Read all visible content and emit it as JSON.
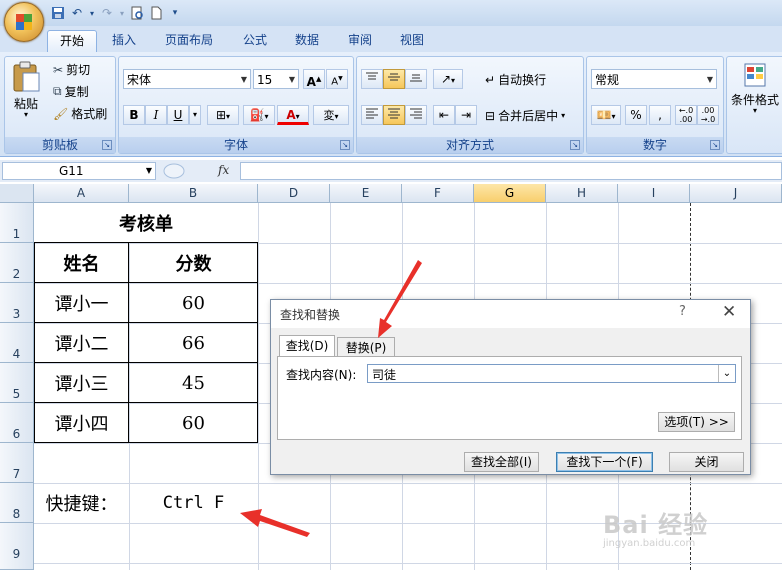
{
  "name_box": "G11",
  "formula_bar": {
    "fx": "fx",
    "value": ""
  },
  "tabs": [
    "开始",
    "插入",
    "页面布局",
    "公式",
    "数据",
    "审阅",
    "视图"
  ],
  "active_tab": "开始",
  "ribbon": {
    "clipboard": {
      "label": "剪贴板",
      "paste": "粘贴",
      "cut": "剪切",
      "copy": "复制",
      "format_painter": "格式刷"
    },
    "font": {
      "label": "字体",
      "name": "宋体",
      "size": "15",
      "bold": "B",
      "italic": "I",
      "underline": "U",
      "grow": "A",
      "shrink": "A",
      "font_color_letter": "A",
      "phonetic": "wén"
    },
    "alignment": {
      "label": "对齐方式",
      "wrap_text": "自动换行",
      "merge_center": "合并后居中"
    },
    "number": {
      "label": "数字",
      "format": "常规",
      "percent": "%",
      "comma": ",",
      "inc_decimal": "+.0\n.00",
      "dec_decimal": ".00\n→.0"
    },
    "styles": {
      "conditional_format": "条件格式"
    }
  },
  "columns": [
    "A",
    "B",
    "D",
    "E",
    "F",
    "G",
    "H",
    "I",
    "J"
  ],
  "selected_column": "G",
  "rows": [
    "1",
    "2",
    "3",
    "4",
    "5",
    "6",
    "7",
    "8",
    "9"
  ],
  "sheet": {
    "title": "考核单",
    "headers": [
      "姓名",
      "分数"
    ],
    "data": [
      {
        "name": "谭小一",
        "score": "60"
      },
      {
        "name": "谭小二",
        "score": "66"
      },
      {
        "name": "谭小三",
        "score": "45"
      },
      {
        "name": "谭小四",
        "score": "60"
      }
    ],
    "shortcut_label": "快捷键：",
    "shortcut_value": "Ctrl F"
  },
  "dialog": {
    "title": "查找和替换",
    "help": "?",
    "close": "✕",
    "tabs": [
      "查找(D)",
      "替换(P)"
    ],
    "active_tab": "查找(D)",
    "find_label": "查找内容(N):",
    "find_value": "司徒",
    "options_button": "选项(T) >>",
    "find_all_button": "查找全部(I)",
    "find_next_button": "查找下一个(F)",
    "close_button": "关闭"
  },
  "watermark": {
    "logo": "Bai  经验",
    "url": "jingyan.baidu.com"
  },
  "colors": {
    "arrow": "#e8302a",
    "selected_header": "#f8cf6d",
    "ribbon": "#d2e1f4"
  }
}
